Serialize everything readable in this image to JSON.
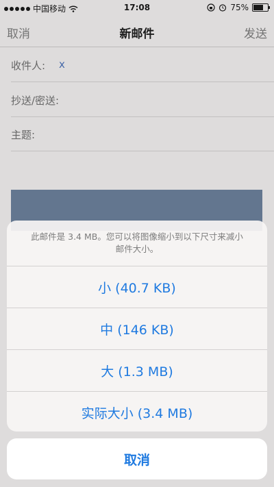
{
  "status_bar": {
    "carrier": "中国移动",
    "time": "17:08",
    "battery_percent": "75%",
    "battery_level": 0.75
  },
  "compose": {
    "cancel_label": "取消",
    "title": "新邮件",
    "send_label": "发送",
    "to_label": "收件人:",
    "to_value": "x",
    "cc_label": "抄送/密送:",
    "subject_label": "主题:"
  },
  "action_sheet": {
    "message": "此邮件是 3.4 MB。您可以将图像缩小到以下尺寸来减小邮件大小。",
    "options": [
      {
        "label": "小 (40.7 KB)"
      },
      {
        "label": "中 (146 KB)"
      },
      {
        "label": "大 (1.3 MB)"
      },
      {
        "label": "实际大小 (3.4 MB)"
      }
    ],
    "cancel_label": "取消"
  },
  "colors": {
    "accent": "#1f7ae0",
    "attachment_preview": "#6a7e98"
  }
}
